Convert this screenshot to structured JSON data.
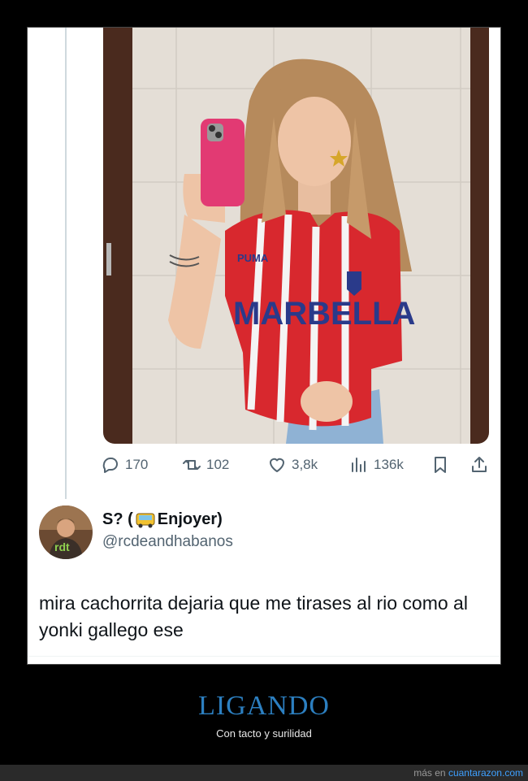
{
  "tweet": {
    "stats": {
      "replies": "170",
      "retweets": "102",
      "likes": "3,8k",
      "views": "136k"
    },
    "icons": {
      "reply": "reply-icon",
      "retweet": "retweet-icon",
      "like": "heart-icon",
      "views": "views-chart-icon",
      "bookmark": "bookmark-icon",
      "share": "share-icon"
    },
    "photo": {
      "shirt_text": "MARBELLA",
      "brand": "PUMA"
    }
  },
  "reply": {
    "name_prefix": "S? (",
    "name_suffix": " Enjoyer)",
    "name_emoji": "bus-emoji",
    "handle": "@rcdeandhabanos",
    "avatar_text": "rdt",
    "text": "mira cachorrita dejaria que me tirases al rio como al yonki gallego ese"
  },
  "post": {
    "title": "LIGANDO",
    "subtitle": "Con tacto y surilidad"
  },
  "footer": {
    "prefix": "más en ",
    "site": "cuantarazon.com"
  },
  "colors": {
    "title": "#2c7fc0",
    "link": "#3ea0ff",
    "jersey_red": "#d8282e",
    "phone_pink": "#e23a73"
  }
}
